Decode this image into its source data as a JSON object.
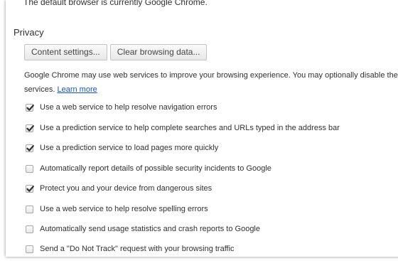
{
  "header": {
    "default_browser_note": "The default browser is currently Google Chrome."
  },
  "privacy": {
    "title": "Privacy",
    "buttons": {
      "content_settings": "Content settings...",
      "clear_browsing_data": "Clear browsing data..."
    },
    "description_line1": "Google Chrome may use web services to improve your browsing experience. You may optionally disable these",
    "description_line2": "services. ",
    "learn_more": "Learn more",
    "options": [
      {
        "label": "Use a web service to help resolve navigation errors",
        "checked": true
      },
      {
        "label": "Use a prediction service to help complete searches and URLs typed in the address bar",
        "checked": true
      },
      {
        "label": "Use a prediction service to load pages more quickly",
        "checked": true
      },
      {
        "label": "Automatically report details of possible security incidents to Google",
        "checked": false
      },
      {
        "label": "Protect you and your device from dangerous sites",
        "checked": true
      },
      {
        "label": "Use a web service to help resolve spelling errors",
        "checked": false
      },
      {
        "label": "Automatically send usage statistics and crash reports to Google",
        "checked": false
      },
      {
        "label": "Send a \"Do Not Track\" request with your browsing traffic",
        "checked": false
      }
    ]
  },
  "colors": {
    "link": "#1155cc",
    "check_mark": "#303030"
  },
  "icons": {
    "checked": "checkmark-icon"
  }
}
